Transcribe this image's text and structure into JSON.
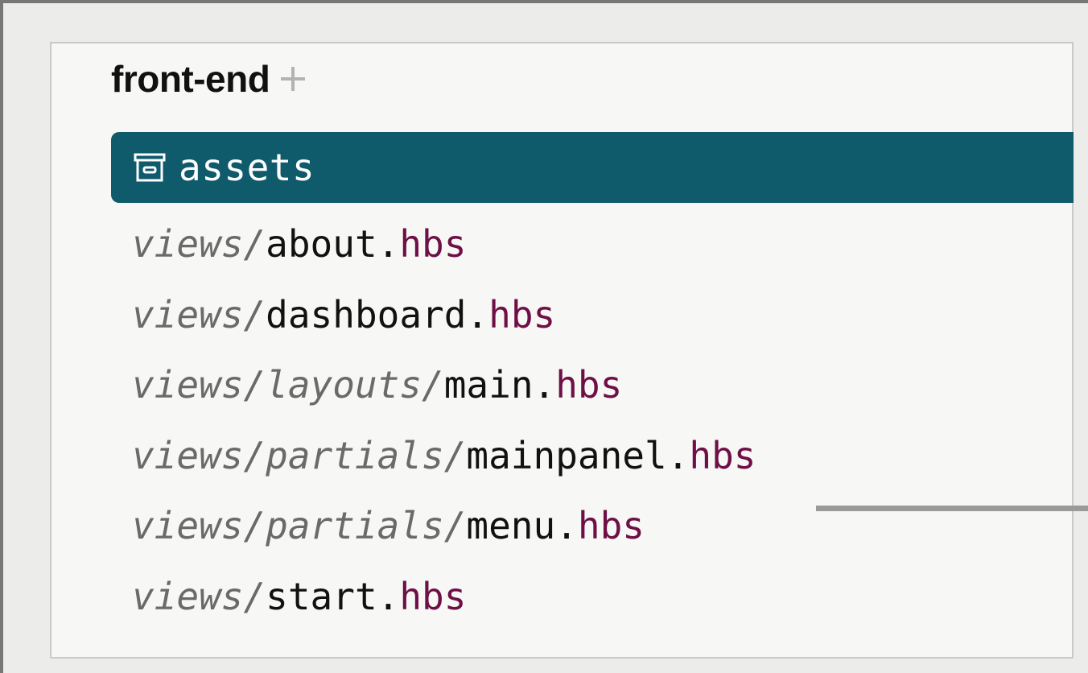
{
  "project": {
    "name": "front-end",
    "add_icon": "plus-icon"
  },
  "selected": {
    "icon": "archive-icon",
    "label": "assets"
  },
  "files": [
    {
      "dir": "views/",
      "name": "about",
      "dot": ".",
      "ext": "hbs"
    },
    {
      "dir": "views/",
      "name": "dashboard",
      "dot": ".",
      "ext": "hbs"
    },
    {
      "dir": "views/layouts/",
      "name": "main",
      "dot": ".",
      "ext": "hbs"
    },
    {
      "dir": "views/partials/",
      "name": "mainpanel",
      "dot": ".",
      "ext": "hbs"
    },
    {
      "dir": "views/partials/",
      "name": "menu",
      "dot": ".",
      "ext": "hbs"
    },
    {
      "dir": "views/",
      "name": "start",
      "dot": ".",
      "ext": "hbs"
    }
  ],
  "colors": {
    "selection": "#0f5a6b",
    "extension": "#6e0f45",
    "directory": "#6a6a6a"
  }
}
